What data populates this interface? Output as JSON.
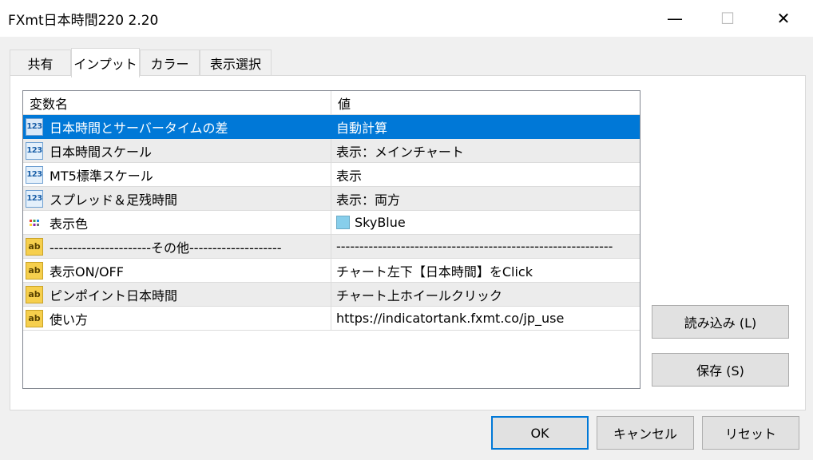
{
  "window": {
    "title": "FXmt日本時間220 2.20",
    "min_glyph": "—",
    "max_glyph": "☐",
    "close_glyph": "✕"
  },
  "tabs": [
    {
      "label": "共有"
    },
    {
      "label": "インプット"
    },
    {
      "label": "カラー"
    },
    {
      "label": "表示選択"
    }
  ],
  "active_tab": "インプット",
  "grid": {
    "headers": {
      "name": "変数名",
      "value": "値"
    },
    "icon_text": {
      "num": "123",
      "ab": "ab"
    },
    "rows": [
      {
        "icon": "number",
        "name": "日本時間とサーバータイムの差",
        "value": "自動計算"
      },
      {
        "icon": "number",
        "name": "日本時間スケール",
        "value": "表示：メインチャート"
      },
      {
        "icon": "number",
        "name": "MT5標準スケール",
        "value": "表示"
      },
      {
        "icon": "number",
        "name": "スプレッド＆足残時間",
        "value": "表示：両方"
      },
      {
        "icon": "color",
        "name": "表示色",
        "value": "SkyBlue"
      },
      {
        "icon": "string",
        "name": "----------------------その他--------------------",
        "value": "------------------------------------------------------------"
      },
      {
        "icon": "string",
        "name": "表示ON/OFF",
        "value": "チャート左下【日本時間】をClick"
      },
      {
        "icon": "string",
        "name": "ピンポイント日本時間",
        "value": "チャート上ホイールクリック"
      },
      {
        "icon": "string",
        "name": "使い方",
        "value": "https://indicatortank.fxmt.co/jp_use"
      }
    ]
  },
  "colors": {
    "selection": "#0078d7",
    "skyblue_swatch": "#87ceeb",
    "string_icon": "#f6cf4d"
  },
  "side_buttons": {
    "load": "読み込み (L)",
    "save": "保存 (S)"
  },
  "footer_buttons": {
    "ok": "OK",
    "cancel": "キャンセル",
    "reset": "リセット"
  }
}
